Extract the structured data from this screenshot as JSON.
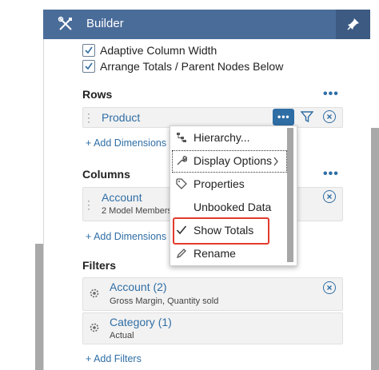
{
  "header": {
    "title": "Builder",
    "tools_icon": "tools-icon",
    "pin_icon": "pin-icon"
  },
  "options": [
    {
      "label": "Adaptive Column Width",
      "checked": true
    },
    {
      "label": "Arrange Totals / Parent Nodes Below",
      "checked": true
    }
  ],
  "rows": {
    "title": "Rows",
    "item": "Product",
    "add_label": "+ Add Dimensions"
  },
  "columns": {
    "title": "Columns",
    "item": "Account",
    "item_sub": "2 Model Members ·",
    "add_label": "+ Add Dimensions"
  },
  "filters": {
    "title": "Filters",
    "items": [
      {
        "label": "Account (2)",
        "sub": "Gross Margin, Quantity sold"
      },
      {
        "label": "Category (1)",
        "sub": "Actual"
      }
    ],
    "add_label": "+ Add Filters"
  },
  "menu": {
    "items": [
      {
        "label": "Hierarchy...",
        "icon": "hierarchy-icon"
      },
      {
        "label": "Display Options",
        "icon": "wrench-icon",
        "submenu": true
      },
      {
        "label": "Properties",
        "icon": "tag-icon"
      },
      {
        "label": "Unbooked Data",
        "icon": ""
      },
      {
        "label": "Show Totals",
        "icon": "checkmark-icon",
        "checked": true
      },
      {
        "label": "Rename",
        "icon": "pencil-icon"
      }
    ]
  },
  "colors": {
    "header": "#4a6c99",
    "accent": "#2f6ea5",
    "highlight": "#e23b2e"
  }
}
